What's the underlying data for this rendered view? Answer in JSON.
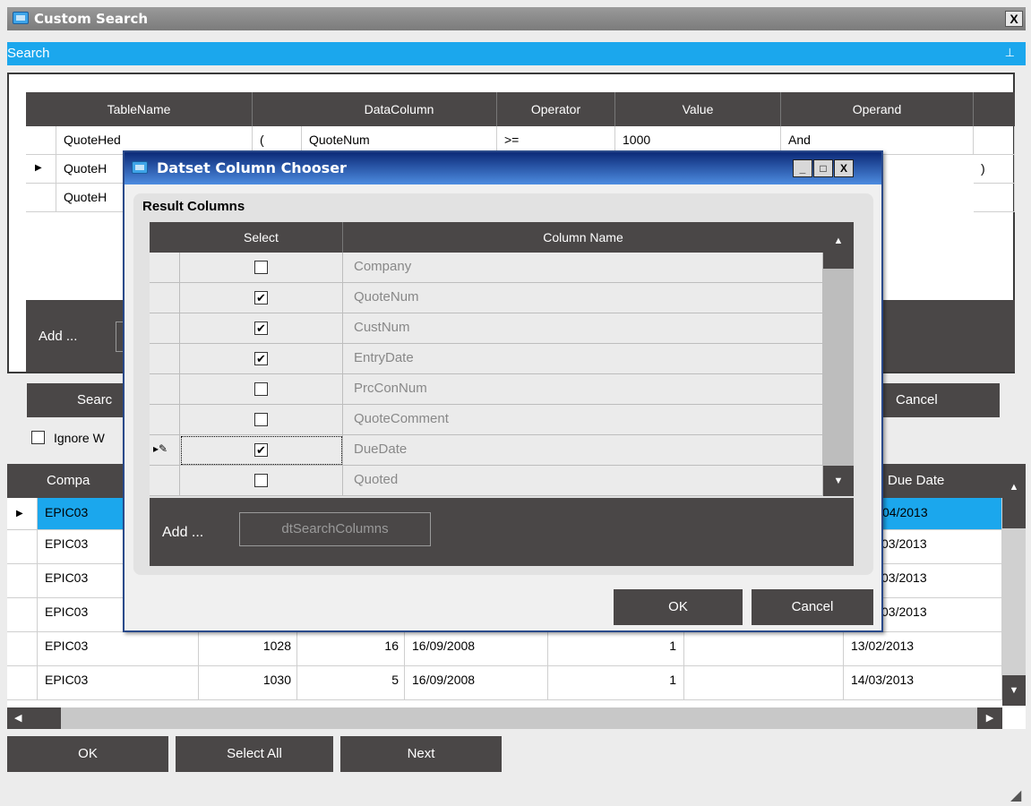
{
  "window": {
    "title": "Custom Search",
    "close_label": "X"
  },
  "search_bar": {
    "label": "Search",
    "pin": "⊥"
  },
  "criteria": {
    "headers": [
      "TableName",
      "",
      "DataColumn",
      "Operator",
      "Value",
      "Operand",
      ""
    ],
    "rows": [
      {
        "table": "QuoteHed",
        "paren": "(",
        "column": "QuoteNum",
        "operator": ">=",
        "value": "1000",
        "operand": "And",
        "close": ""
      },
      {
        "table": "QuoteH",
        "paren": "",
        "column": "",
        "operator": "",
        "value": "",
        "operand": "",
        "close": ")"
      },
      {
        "table": "QuoteH",
        "paren": "",
        "column": "",
        "operator": "",
        "value": "",
        "operand": "",
        "close": ""
      }
    ],
    "add_label": "Add ..."
  },
  "buttons": {
    "search": "Searc",
    "cancel": "Cancel",
    "ignore": "Ignore W",
    "ok": "OK",
    "select_all": "Select All",
    "next": "Next"
  },
  "results": {
    "headers": {
      "company": "Compa",
      "due_date": "Due Date"
    },
    "rows": [
      {
        "company": "EPIC03",
        "quote": "",
        "cust": "",
        "date": "",
        "qty": "",
        "due": "04/2013"
      },
      {
        "company": "EPIC03",
        "quote": "",
        "cust": "",
        "date": "",
        "qty": "",
        "due": "03/2013"
      },
      {
        "company": "EPIC03",
        "quote": "",
        "cust": "",
        "date": "",
        "qty": "",
        "due": "03/2013"
      },
      {
        "company": "EPIC03",
        "quote": "",
        "cust": "",
        "date": "",
        "qty": "",
        "due": "03/2013"
      },
      {
        "company": "EPIC03",
        "quote": "1028",
        "cust": "16",
        "date": "16/09/2008",
        "qty": "1",
        "due": "13/02/2013"
      },
      {
        "company": "EPIC03",
        "quote": "1030",
        "cust": "5",
        "date": "16/09/2008",
        "qty": "1",
        "due": "14/03/2013"
      }
    ]
  },
  "dialog": {
    "title": "Datset Column Chooser",
    "controls": {
      "min": "_",
      "max": "□",
      "close": "X"
    },
    "group_label": "Result Columns",
    "headers": {
      "select": "Select",
      "column_name": "Column Name"
    },
    "rows": [
      {
        "name": "Company",
        "checked": false
      },
      {
        "name": "QuoteNum",
        "checked": true
      },
      {
        "name": "CustNum",
        "checked": true
      },
      {
        "name": "EntryDate",
        "checked": true
      },
      {
        "name": "PrcConNum",
        "checked": false
      },
      {
        "name": "QuoteComment",
        "checked": false
      },
      {
        "name": "DueDate",
        "checked": true
      },
      {
        "name": "Quoted",
        "checked": false
      }
    ],
    "add_label": "Add ...",
    "dataset_button": "dtSearchColumns",
    "ok": "OK",
    "cancel": "Cancel"
  }
}
